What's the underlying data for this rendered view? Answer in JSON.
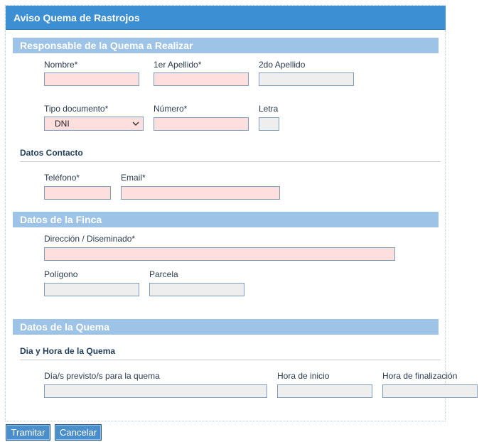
{
  "form": {
    "title": "Aviso Quema de Rastrojos"
  },
  "responsable": {
    "section_title": "Responsable de la Quema a Realizar",
    "nombre_label": "Nombre*",
    "apellido1_label": "1er Apellido*",
    "apellido2_label": "2do Apellido",
    "tipo_doc_label": "Tipo documento*",
    "tipo_doc_value": "DNI",
    "numero_label": "Número*",
    "letra_label": "Letra"
  },
  "contacto": {
    "subtitle": "Datos Contacto",
    "telefono_label": "Teléfono*",
    "email_label": "Email*"
  },
  "finca": {
    "section_title": "Datos de la Finca",
    "direccion_label": "Dirección / Diseminado*",
    "poligono_label": "Polígono",
    "parcela_label": "Parcela"
  },
  "quema": {
    "section_title": "Datos de la Quema",
    "subtitle": "Dia y Hora de la Quema",
    "dias_label": "Día/s previsto/s para la quema",
    "hora_inicio_label": "Hora de inicio",
    "hora_fin_label": "Hora de finalización"
  },
  "actions": {
    "tramitar_label": "Tramitar",
    "cancelar_label": "Cancelar"
  },
  "colors": {
    "title_bar": "#3d8fd4",
    "section_bar": "#9dc3e6",
    "required_field": "#ffdede",
    "optional_field": "#eeeeee",
    "button": "#4a8fcb"
  },
  "icons": {
    "select_arrow": "chevron-down-icon"
  }
}
